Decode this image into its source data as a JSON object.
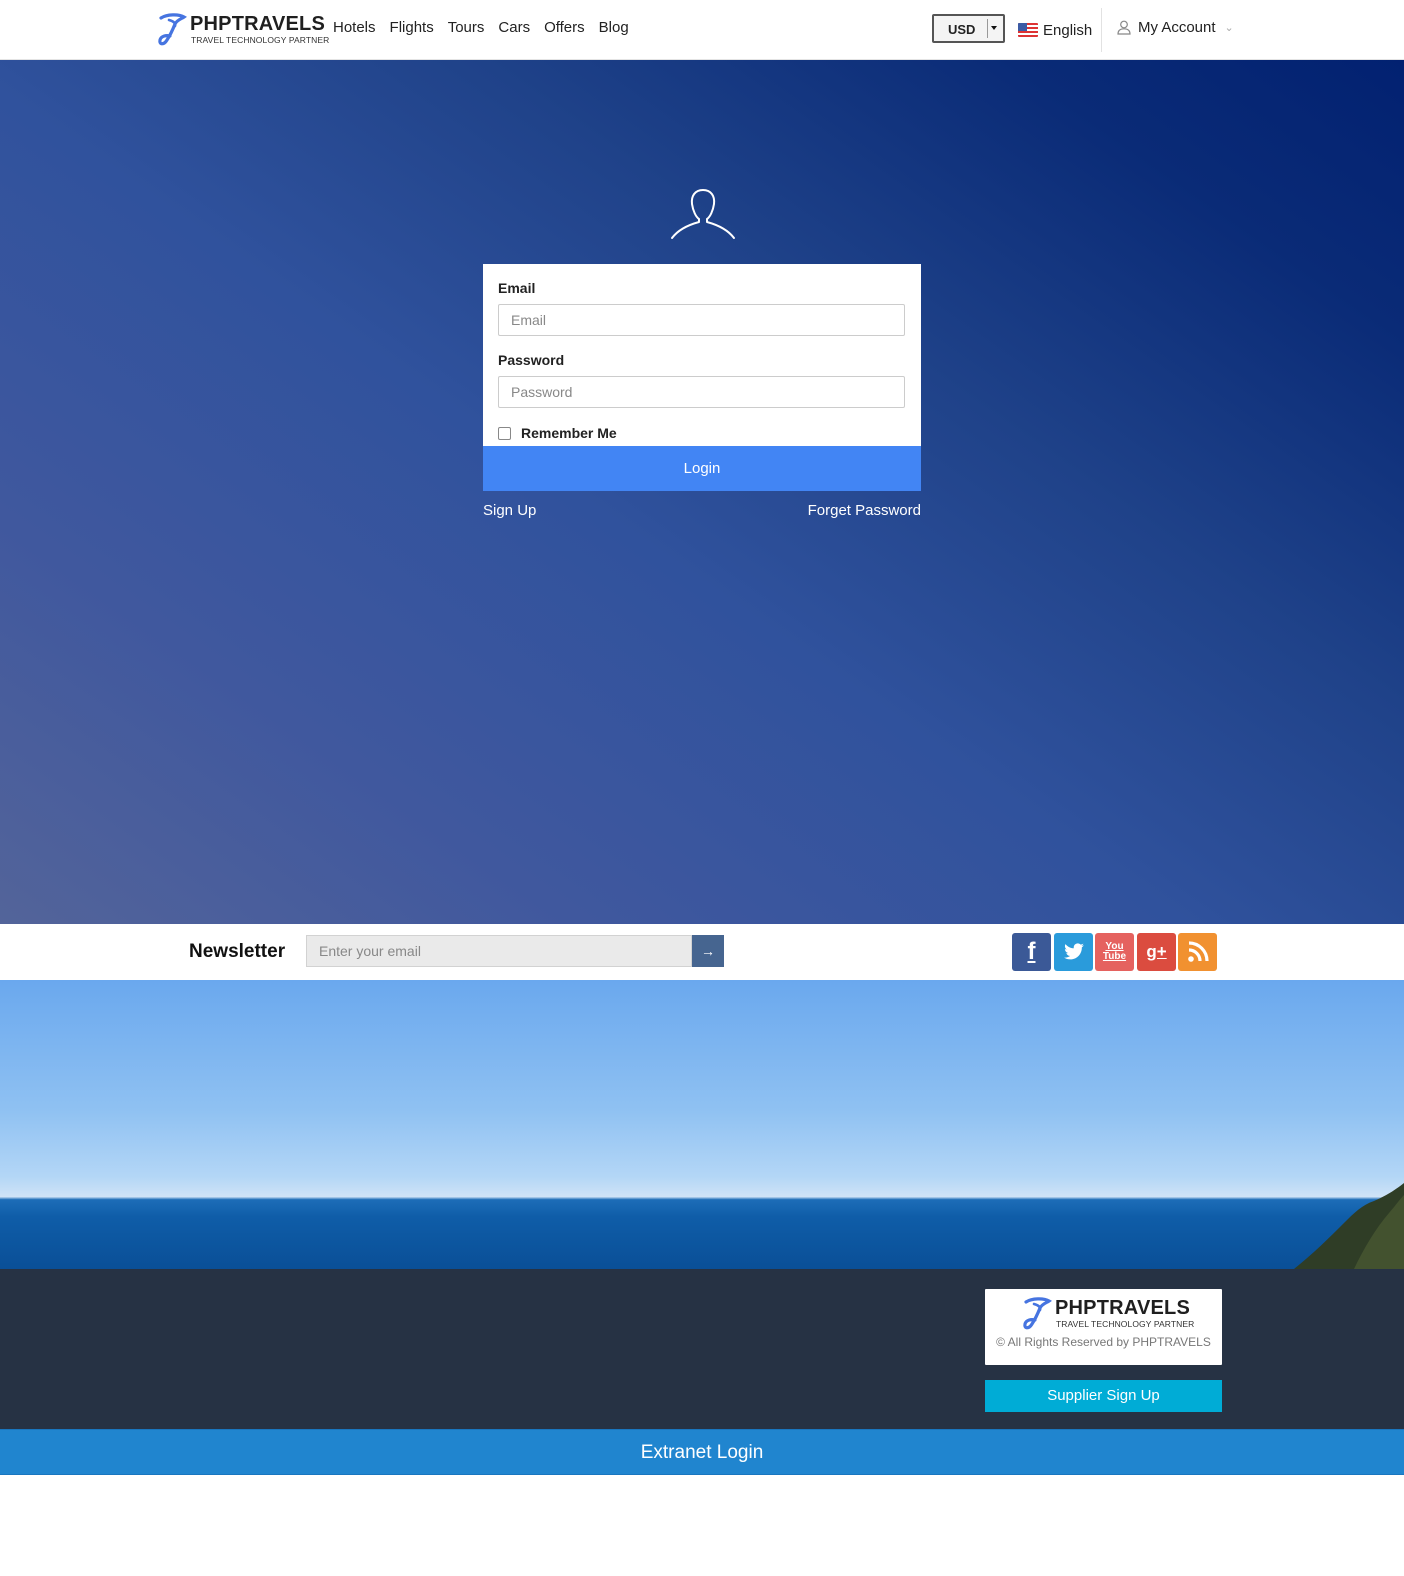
{
  "brand": {
    "name": "PHPTRAVELS",
    "tagline": "TRAVEL TECHNOLOGY PARTNER",
    "color": "#4674e0"
  },
  "nav": {
    "items": [
      {
        "label": "Hotels"
      },
      {
        "label": "Flights"
      },
      {
        "label": "Tours"
      },
      {
        "label": "Cars"
      },
      {
        "label": "Offers"
      },
      {
        "label": "Blog"
      }
    ]
  },
  "header": {
    "currency": "USD",
    "language": "English",
    "account": "My Account"
  },
  "login": {
    "email_label": "Email",
    "email_placeholder": "Email",
    "password_label": "Password",
    "password_placeholder": "Password",
    "remember_label": "Remember Me",
    "submit_label": "Login",
    "signup_link": "Sign Up",
    "forgot_link": "Forget Password"
  },
  "newsletter": {
    "title": "Newsletter",
    "placeholder": "Enter your email",
    "social": [
      {
        "name": "facebook-icon",
        "color": "#3b5997"
      },
      {
        "name": "twitter-icon",
        "color": "#2a9bdb"
      },
      {
        "name": "youtube-icon",
        "color": "#e5625f",
        "text_top": "You",
        "text_bottom": "Tube"
      },
      {
        "name": "google-plus-icon",
        "color": "#db4c3f"
      },
      {
        "name": "rss-icon",
        "color": "#f19130"
      }
    ]
  },
  "footer": {
    "copyright": "© All Rights Reserved by PHPTRAVELS",
    "supplier_signup": "Supplier Sign Up",
    "extranet_login": "Extranet Login"
  },
  "colors": {
    "accent": "#4285f4",
    "footer_bg": "#263244",
    "extranet_bg": "#2085cf",
    "supplier_bg": "#00acd6"
  }
}
